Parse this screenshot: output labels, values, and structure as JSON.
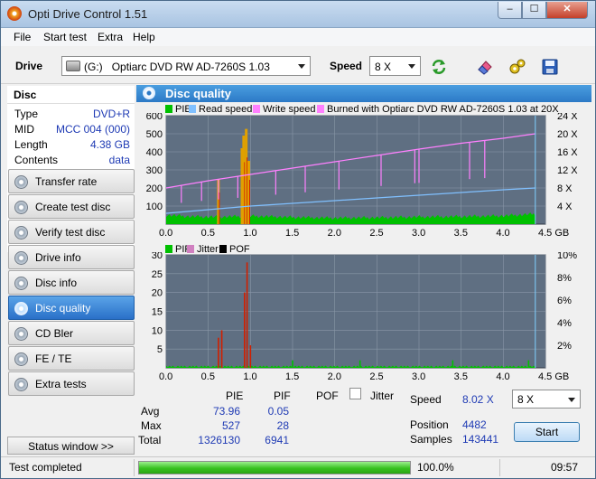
{
  "window": {
    "title": "Opti Drive Control 1.51",
    "min_glyph": "–",
    "max_glyph": "☐",
    "close_glyph": "✕"
  },
  "menu": {
    "items": [
      "File",
      "Start test",
      "Extra",
      "Help"
    ]
  },
  "toolbar": {
    "drive_label": "Drive",
    "drive_letter": "(G:)",
    "drive_name": "Optiarc DVD RW AD-7260S 1.03",
    "speed_label": "Speed",
    "speed_value": "8 X"
  },
  "disc": {
    "title": "Disc",
    "rows": [
      {
        "label": "Type",
        "value": "DVD+R"
      },
      {
        "label": "MID",
        "value": "MCC 004 (000)"
      },
      {
        "label": "Length",
        "value": "4.38 GB"
      },
      {
        "label": "Contents",
        "value": "data"
      }
    ]
  },
  "nav": {
    "items": [
      "Transfer rate",
      "Create test disc",
      "Verify test disc",
      "Drive info",
      "Disc info",
      "Disc quality",
      "CD Bler",
      "FE / TE",
      "Extra tests"
    ],
    "active_index": 5,
    "status_window": "Status window >>"
  },
  "main": {
    "title": "Disc quality"
  },
  "colors": {
    "pie": "#00c000",
    "read": "#80c0ff",
    "write": "#ff80ff",
    "burn": "#ff80ff",
    "pif": "#00c000",
    "jitter": "#d080c0",
    "pof": "#000000",
    "plot_bg": "#5f6f82"
  },
  "chart_data": [
    {
      "type": "line",
      "legend": [
        "PIE",
        "Read speed",
        "Write speed",
        "Burned with Optiarc DVD RW AD-7260S 1.03 at 20X"
      ],
      "xlim": [
        0,
        4.5
      ],
      "x_ticks": [
        "0.0",
        "0.5",
        "1.0",
        "1.5",
        "2.0",
        "2.5",
        "3.0",
        "3.5",
        "4.0",
        "4.5 GB"
      ],
      "ylim": [
        0,
        600
      ],
      "y_ticks": [
        "100",
        "200",
        "300",
        "400",
        "500",
        "600"
      ],
      "y2lim": [
        0,
        24
      ],
      "y2_ticks": [
        "4 X",
        "8 X",
        "12 X",
        "16 X",
        "20 X",
        "24 X"
      ],
      "pie_baseline": [
        [
          0.0,
          50
        ],
        [
          0.3,
          42
        ],
        [
          0.6,
          40
        ],
        [
          1.0,
          45
        ],
        [
          1.5,
          38
        ],
        [
          2.0,
          34
        ],
        [
          2.5,
          36
        ],
        [
          3.0,
          40
        ],
        [
          3.5,
          42
        ],
        [
          4.0,
          46
        ],
        [
          4.5,
          60
        ]
      ],
      "pie_spikes": [
        [
          0.62,
          250
        ],
        [
          0.9,
          420
        ],
        [
          0.92,
          490
        ],
        [
          0.95,
          527
        ],
        [
          0.98,
          350
        ]
      ],
      "read_speed": [
        [
          0.0,
          2.4
        ],
        [
          0.5,
          3.2
        ],
        [
          1.0,
          4.0
        ],
        [
          1.5,
          4.6
        ],
        [
          2.0,
          5.2
        ],
        [
          2.5,
          5.8
        ],
        [
          3.0,
          6.4
        ],
        [
          3.5,
          7.0
        ],
        [
          4.0,
          7.6
        ],
        [
          4.38,
          8.0
        ]
      ],
      "write_speed": [
        [
          0.0,
          8.0
        ],
        [
          0.5,
          9.6
        ],
        [
          1.0,
          11.0
        ],
        [
          1.5,
          12.4
        ],
        [
          2.0,
          13.8
        ],
        [
          2.5,
          15.2
        ],
        [
          3.0,
          16.6
        ],
        [
          3.5,
          17.9
        ],
        [
          4.0,
          19.0
        ],
        [
          4.38,
          20.0
        ]
      ],
      "write_dips": [
        0.18,
        0.42,
        0.62,
        0.85,
        1.3,
        1.65,
        2.05,
        2.55,
        2.95,
        3.0,
        3.6,
        3.78
      ]
    },
    {
      "type": "line",
      "legend": [
        "PIF",
        "Jitter",
        "POF"
      ],
      "xlim": [
        0,
        4.5
      ],
      "x_ticks": [
        "0.0",
        "0.5",
        "1.0",
        "1.5",
        "2.0",
        "2.5",
        "3.0",
        "3.5",
        "4.0",
        "4.5 GB"
      ],
      "ylim": [
        0,
        30
      ],
      "y_ticks": [
        "5",
        "10",
        "15",
        "20",
        "25",
        "30"
      ],
      "y2lim": [
        0,
        10
      ],
      "y2_ticks": [
        "2%",
        "4%",
        "6%",
        "8%",
        "10%"
      ],
      "pif_spikes": [
        [
          0.62,
          8
        ],
        [
          0.66,
          10
        ],
        [
          0.93,
          20
        ],
        [
          0.96,
          28
        ],
        [
          1.0,
          6
        ],
        [
          1.5,
          2
        ],
        [
          2.3,
          2
        ],
        [
          3.4,
          2
        ],
        [
          4.3,
          2
        ]
      ]
    }
  ],
  "stats": {
    "col_pie": "PIE",
    "col_pif": "PIF",
    "col_pof": "POF",
    "jitter_label": "Jitter",
    "avg_label": "Avg",
    "max_label": "Max",
    "total_label": "Total",
    "avg_pie": "73.96",
    "avg_pif": "0.05",
    "max_pie": "527",
    "max_pif": "28",
    "total_pie": "1326130",
    "total_pif": "6941",
    "speed_label": "Speed",
    "speed_value": "8.02 X",
    "speed_select": "8 X",
    "position_label": "Position",
    "position_value": "4482",
    "samples_label": "Samples",
    "samples_value": "143441",
    "start": "Start"
  },
  "status": {
    "text": "Test completed",
    "progress": 100.0,
    "progress_text": "100.0%",
    "time": "09:57"
  }
}
